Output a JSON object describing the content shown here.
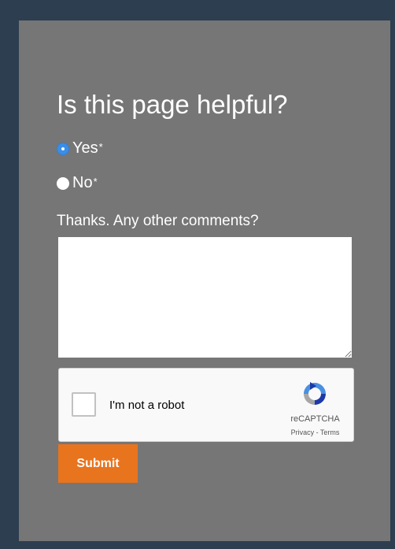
{
  "feedback": {
    "title": "Is this page helpful?",
    "options": [
      {
        "label": "Yes",
        "required_mark": "*",
        "selected": true
      },
      {
        "label": "No",
        "required_mark": "*",
        "selected": false
      }
    ],
    "comments_label": "Thanks. Any other comments?",
    "comments_value": ""
  },
  "recaptcha": {
    "checkbox_label": "I'm not a robot",
    "brand": "reCAPTCHA",
    "terms": "Privacy - Terms",
    "icon": "recaptcha-logo-icon"
  },
  "submit_label": "Submit",
  "colors": {
    "page_background": "#2c3e50",
    "panel_background": "#767676",
    "radio_selected": "#3b8ee8",
    "submit_background": "#e8741e"
  }
}
